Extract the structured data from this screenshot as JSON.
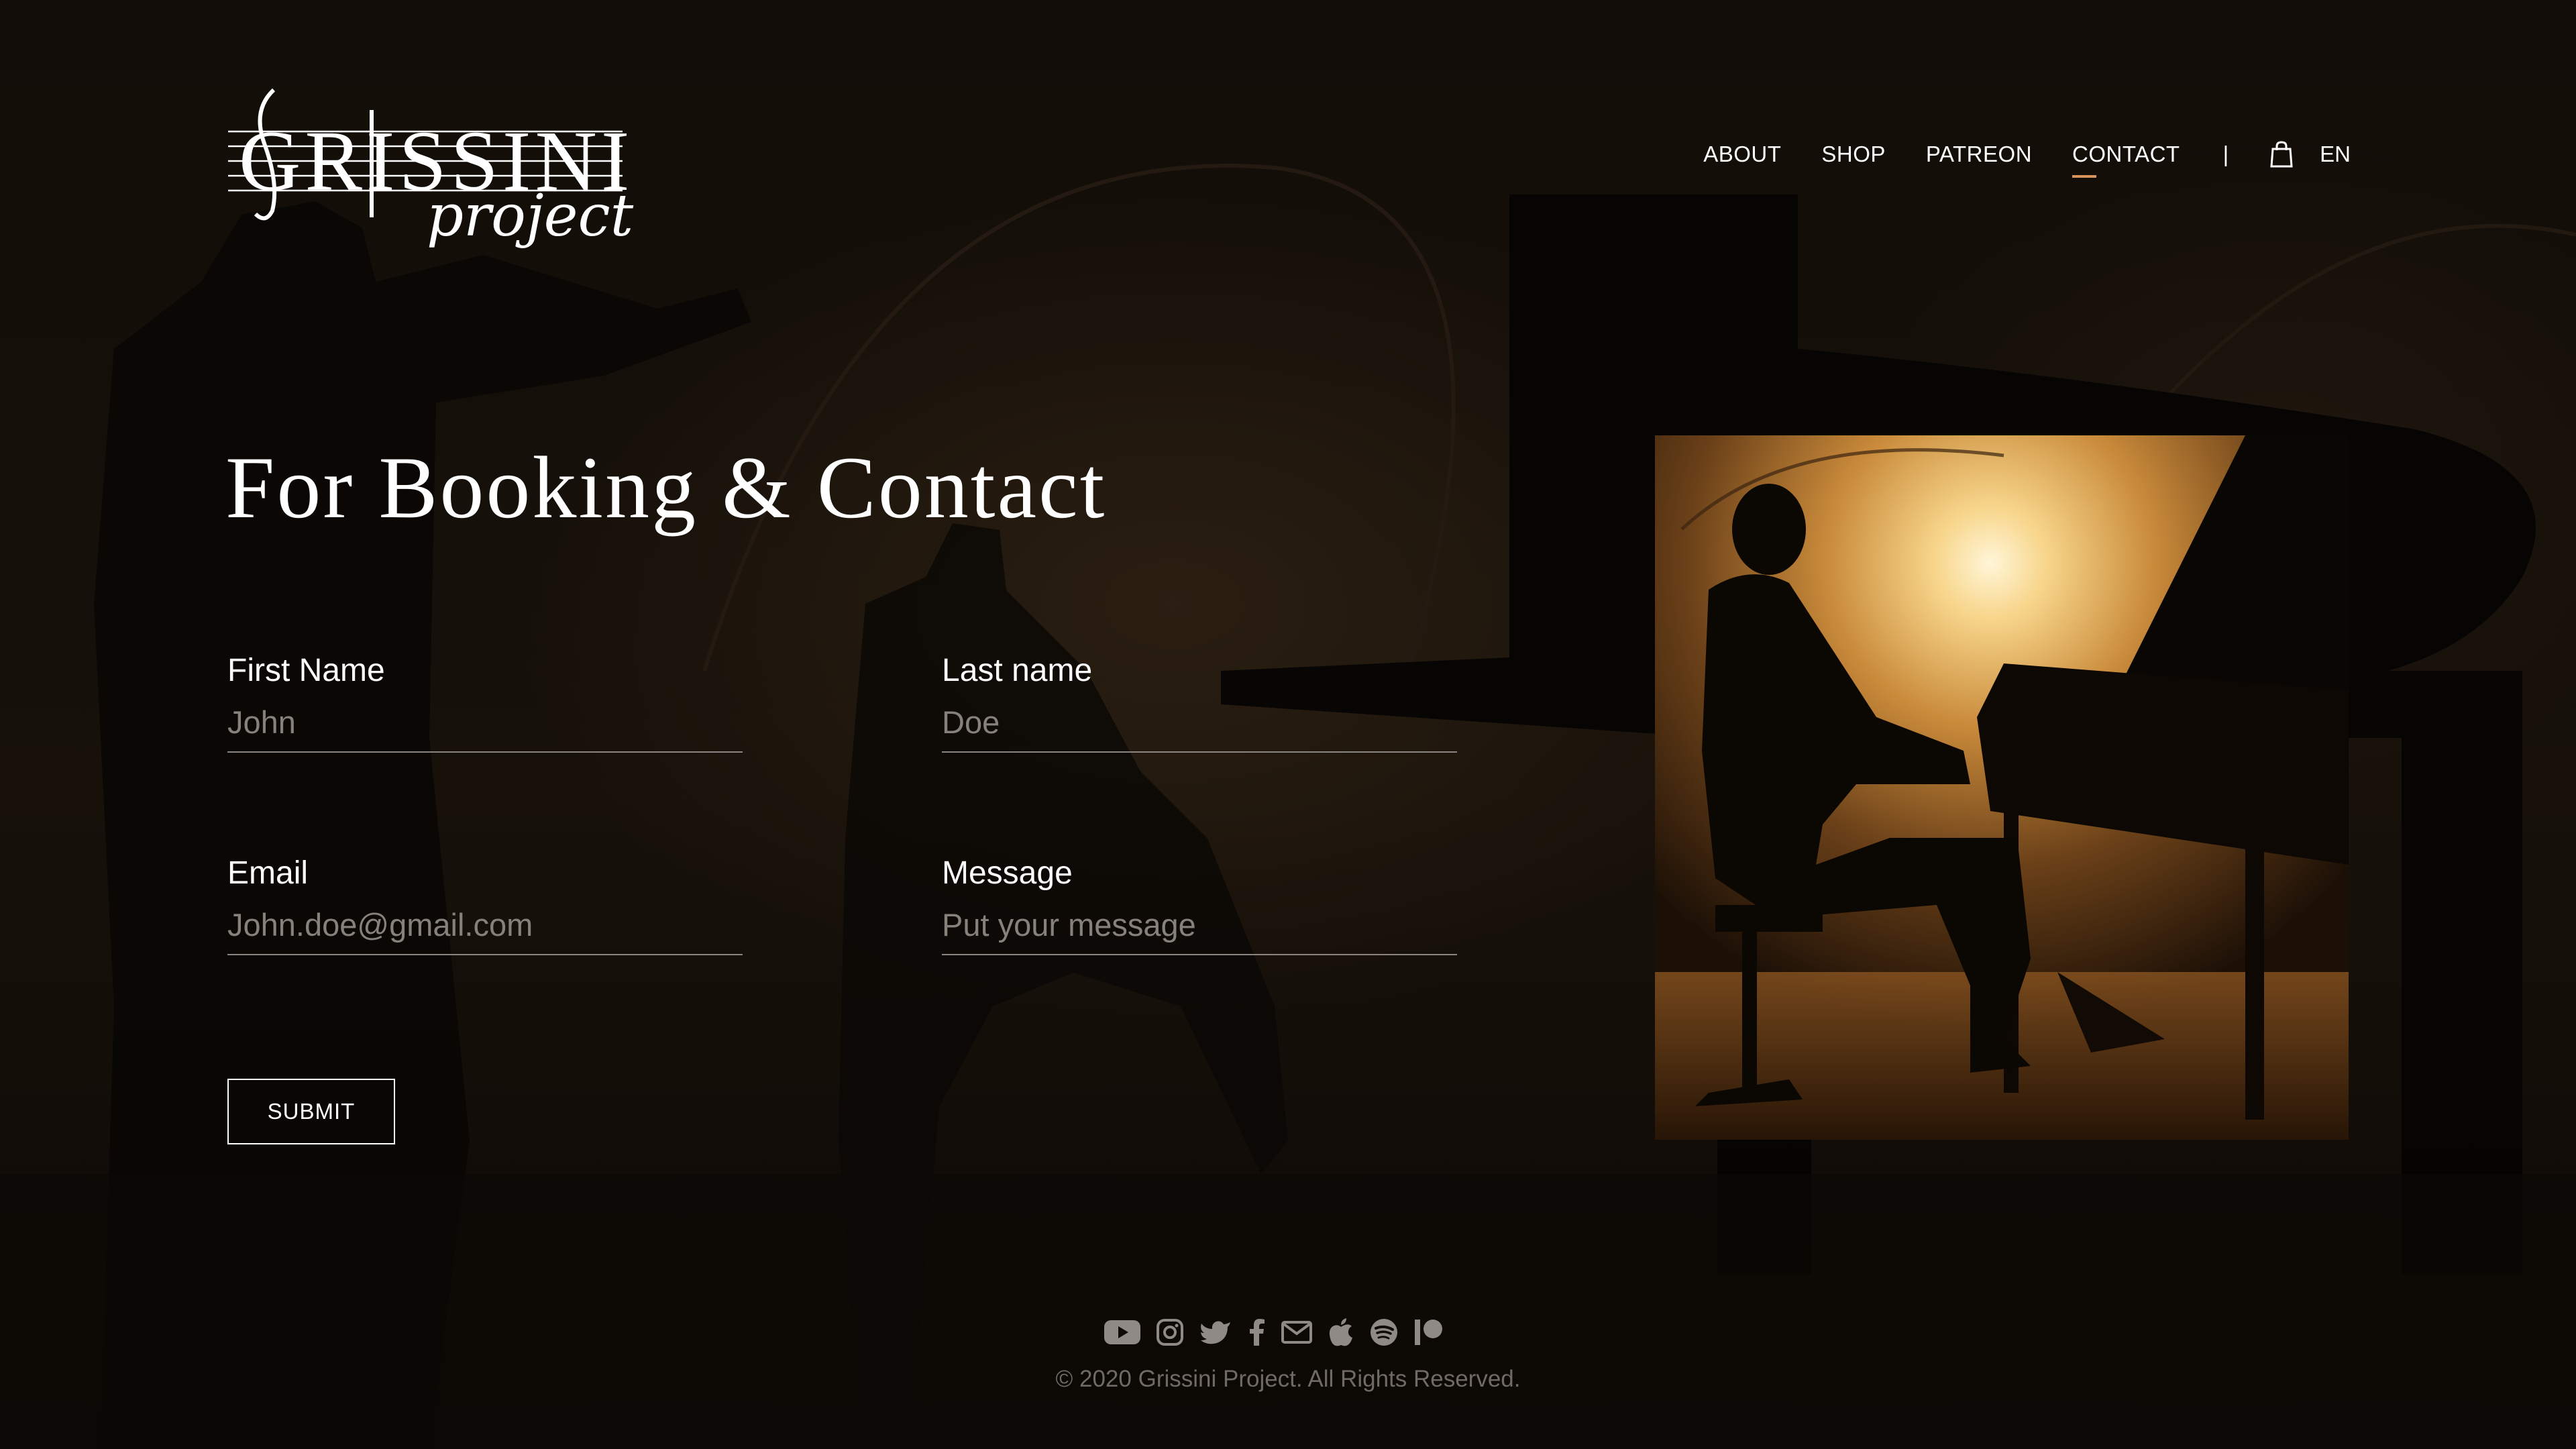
{
  "brand": {
    "logo_main": "GRISSINI",
    "logo_sub": "project"
  },
  "nav": {
    "items": [
      {
        "label": "ABOUT",
        "active": false
      },
      {
        "label": "SHOP",
        "active": false
      },
      {
        "label": "PATREON",
        "active": false
      },
      {
        "label": "CONTACT",
        "active": true
      }
    ],
    "separator": "|",
    "cart_icon": "shopping-bag-icon",
    "language": "EN"
  },
  "page": {
    "title": "For Booking & Contact"
  },
  "form": {
    "first_name": {
      "label": "First Name",
      "placeholder": "John",
      "value": ""
    },
    "last_name": {
      "label": "Last name",
      "placeholder": "Doe",
      "value": ""
    },
    "email": {
      "label": "Email",
      "placeholder": "John.doe@gmail.com",
      "value": ""
    },
    "message": {
      "label": "Message",
      "placeholder": "Put your message",
      "value": ""
    },
    "submit_label": "SUBMIT"
  },
  "footer": {
    "social_icons": [
      "youtube-icon",
      "instagram-icon",
      "twitter-icon",
      "facebook-icon",
      "mail-icon",
      "apple-icon",
      "spotify-icon",
      "patreon-icon"
    ],
    "copyright": "© 2020 Grissini Project. All Rights Reserved."
  },
  "colors": {
    "background": "#0e0a06",
    "accent_underline": "#d8935a",
    "text": "#ffffff",
    "muted": "#6f6a65"
  }
}
